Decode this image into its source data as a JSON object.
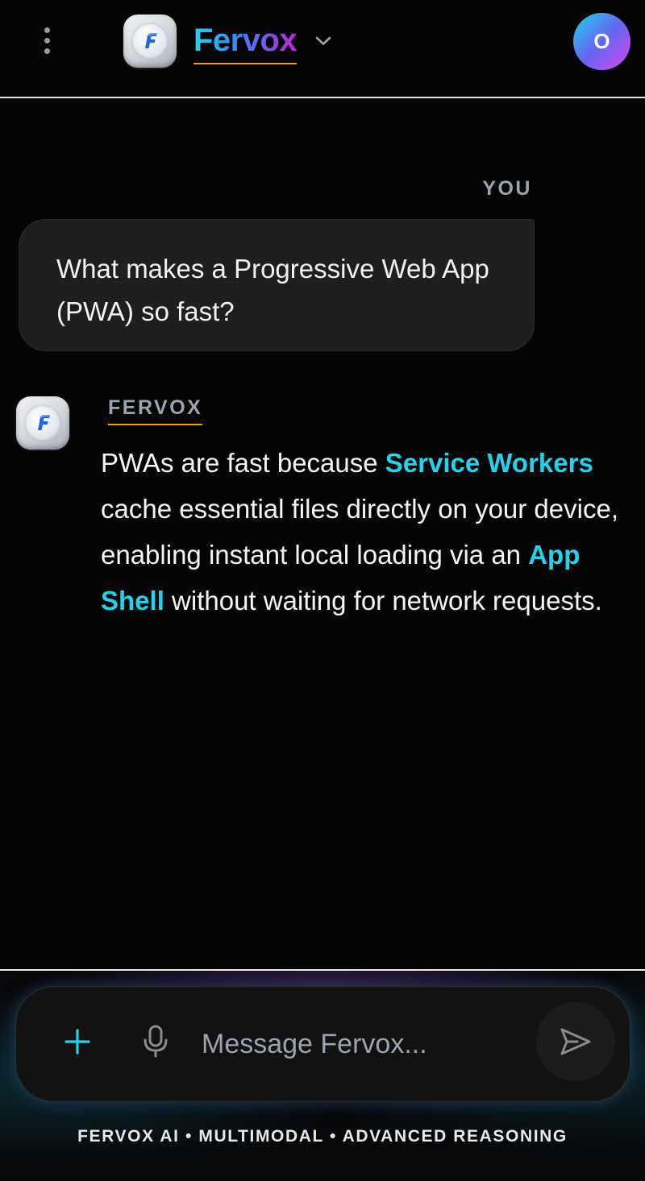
{
  "header": {
    "brand": "Fervox",
    "avatar_initial": "O"
  },
  "chat": {
    "user_label": "YOU",
    "user_message": "What makes a Progressive Web App (PWA) so fast?",
    "ai_label": "FERVOX",
    "ai_message": {
      "part1": "PWAs are fast because ",
      "highlight1": "Service Workers",
      "part2": " cache essential files directly on your device, enabling instant local loading via an ",
      "highlight2": "App Shell",
      "part3": " without waiting for network requests."
    }
  },
  "composer": {
    "placeholder": "Message Fervox...",
    "value": ""
  },
  "footer": {
    "note": "FERVOX AI • MULTIMODAL • ADVANCED REASONING"
  },
  "colors": {
    "accent_cyan": "#22d3ee",
    "accent_violet": "#c026d3",
    "underline_amber": "#f59e0b",
    "bubble_bg": "#1f1f1f"
  },
  "icons": {
    "menu": "more-vertical-icon",
    "logo": "fervox-logo-icon",
    "chevron": "chevron-down-icon",
    "plus": "plus-icon",
    "mic": "microphone-icon",
    "send": "send-icon"
  }
}
